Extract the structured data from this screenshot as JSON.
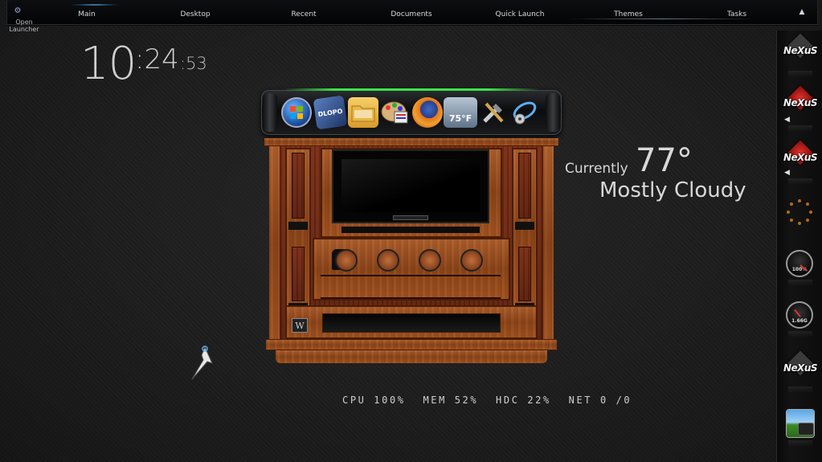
{
  "topbar": {
    "items": [
      "Main",
      "Desktop",
      "Recent",
      "Documents",
      "Quick Launch",
      "Themes",
      "Tasks"
    ],
    "launcher_label": "Open Launcher",
    "icons": {
      "settings": "gear-icon",
      "collapse": "chevron-up-icon"
    }
  },
  "clock": {
    "hours": "10",
    "minutes": ":24",
    "seconds": ":53"
  },
  "weather": {
    "label": "Currently",
    "temp": "77°",
    "condition": "Mostly Cloudy"
  },
  "stats": {
    "cpu": "CPU 100%",
    "mem": "MEM 52%",
    "hdc": "HDC 22%",
    "net": "NET 0 /0"
  },
  "dock": {
    "icons": [
      {
        "name": "windows-start-icon",
        "color": "#2a6fc9"
      },
      {
        "name": "objectdock-icon",
        "label": "DLOPO",
        "color": "#2a4a8c"
      },
      {
        "name": "folder-icon",
        "color": "#e8b84a"
      },
      {
        "name": "paint-palette-icon",
        "color": "#caa060"
      },
      {
        "name": "firefox-icon",
        "color": "#e0641e"
      },
      {
        "name": "weather-widget-icon",
        "label": "75°F",
        "color": "#8fa3b8"
      },
      {
        "name": "tools-icon",
        "color": "#9aa0a6"
      },
      {
        "name": "system-settings-icon",
        "color": "#2c88d0"
      }
    ]
  },
  "cabinet": {
    "badge": "W"
  },
  "sidebar": {
    "logo_text": "NeXuS",
    "gauge1_label": "100%",
    "gauge2_label": "1.66G",
    "accent": "#e5312b"
  }
}
